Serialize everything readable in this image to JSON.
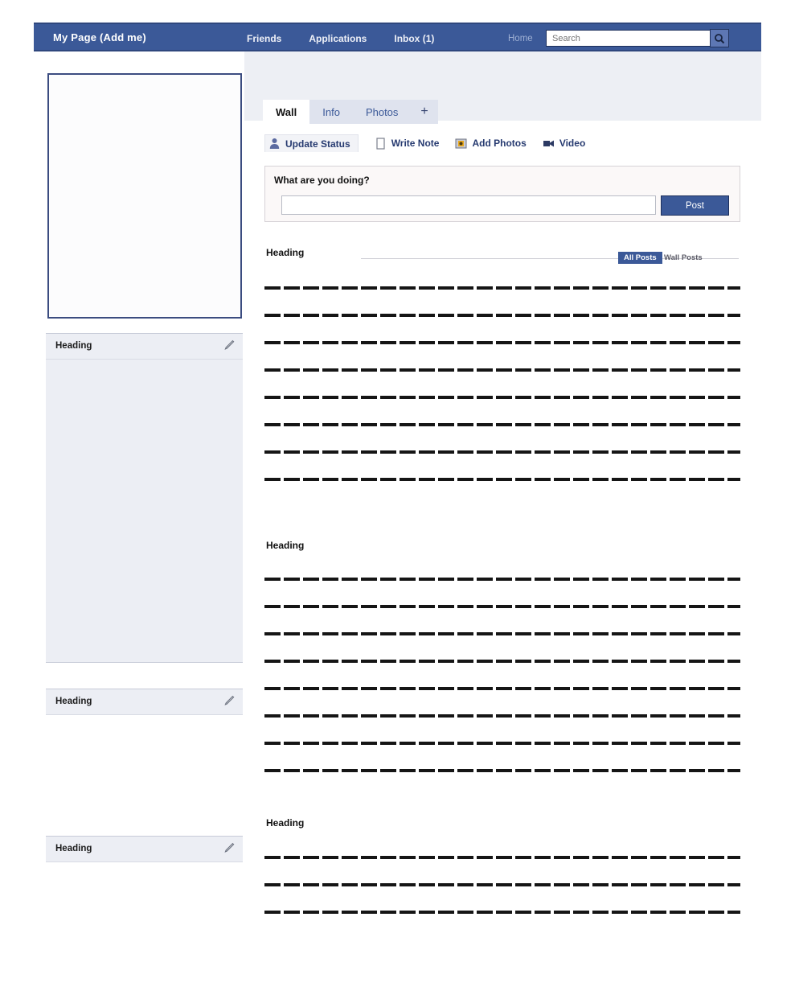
{
  "header": {
    "brand": "My Page (Add me)",
    "nav": [
      {
        "label": "Friends"
      },
      {
        "label": "Applications"
      },
      {
        "label": "Inbox (1)"
      }
    ],
    "home_label": "Home",
    "search": {
      "placeholder": "Search",
      "value": ""
    },
    "search_button_icon": "search-icon",
    "colors": {
      "bar": "#3b5998",
      "bar_border": "#2f477d"
    }
  },
  "sidebar": {
    "photo_placeholder": "",
    "panels": [
      {
        "title": "Heading",
        "edit_icon": "pencil-icon"
      },
      {
        "title": "Heading",
        "edit_icon": "pencil-icon"
      },
      {
        "title": "Heading",
        "edit_icon": "pencil-icon"
      }
    ]
  },
  "main": {
    "tabs": [
      {
        "label": "Wall",
        "active": true
      },
      {
        "label": "Info",
        "active": false
      },
      {
        "label": "Photos",
        "active": false
      },
      {
        "label": "+",
        "active": false
      }
    ],
    "actions": [
      {
        "label": "Update Status",
        "icon": "person-icon"
      },
      {
        "label": "Write Note",
        "icon": "note-icon"
      },
      {
        "label": "Add Photos",
        "icon": "photo-icon"
      },
      {
        "label": "Video",
        "icon": "video-icon"
      }
    ],
    "composer": {
      "prompt": "What are you doing?",
      "input_value": "",
      "input_placeholder": "",
      "post_label": "Post"
    },
    "feed_filter": {
      "heading": "Heading",
      "selected_label": "All Posts",
      "other_label": "Wall Posts"
    },
    "sections": [
      {
        "heading": "",
        "line_count": 8
      },
      {
        "heading": "Heading",
        "line_count": 8
      },
      {
        "heading": "Heading",
        "line_count": 3
      }
    ]
  }
}
